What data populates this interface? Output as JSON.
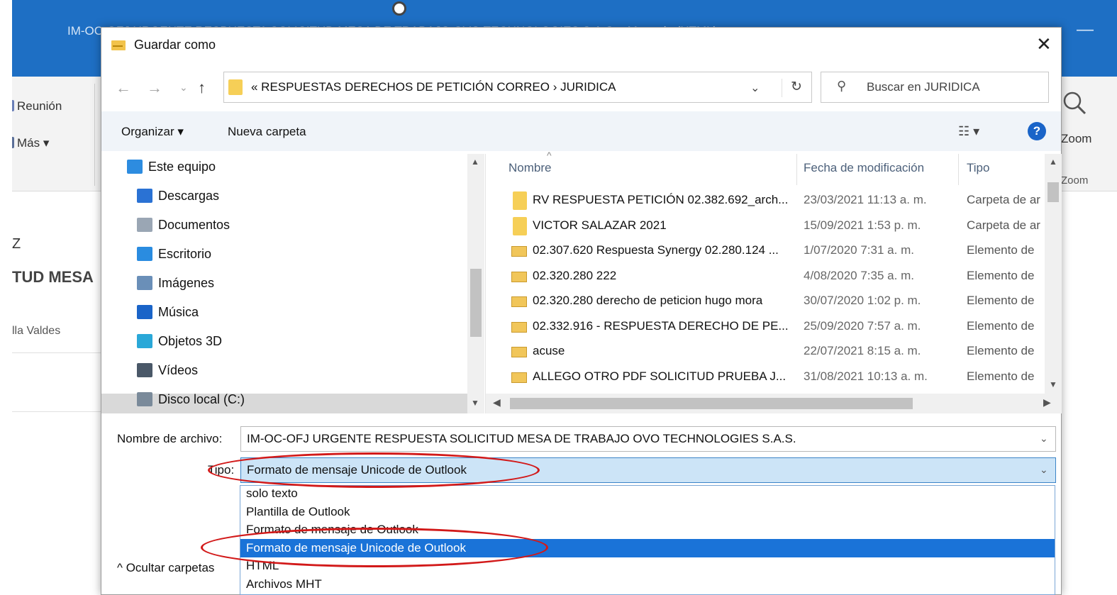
{
  "background": {
    "window_title": "IM-OC-OFJ URGENTE RESPUESTA SOLICITUD MESA DE TRABAJO OVO TECHNOLOGIES S.A.S. - Mensaje (HTML)",
    "minimize_glyph": "—",
    "ribbon": {
      "meeting_label": "Reunión",
      "more_label": "Más ▾",
      "zoom_label": "Zoom",
      "zoom_group_label": "Zoom"
    },
    "body": {
      "line1": "Z",
      "line2": "TUD MESA",
      "line3": "lla Valdes"
    }
  },
  "dialog": {
    "title": "Guardar como",
    "close_glyph": "✕",
    "address_path": "« RESPUESTAS DERECHOS DE PETICIÓN CORREO › JURIDICA",
    "search_placeholder": "Buscar en JURIDICA",
    "commands": {
      "organize": "Organizar ▾",
      "new_folder": "Nueva carpeta",
      "help": "?"
    },
    "tree": [
      {
        "label": "Este equipo",
        "icon": "computer-icon",
        "color": "#2d8ce0"
      },
      {
        "label": "Descargas",
        "icon": "download-icon",
        "color": "#2a72d4"
      },
      {
        "label": "Documentos",
        "icon": "documents-icon",
        "color": "#9aa6b4"
      },
      {
        "label": "Escritorio",
        "icon": "desktop-icon",
        "color": "#2a8ce0"
      },
      {
        "label": "Imágenes",
        "icon": "pictures-icon",
        "color": "#6a8fb8"
      },
      {
        "label": "Música",
        "icon": "music-icon",
        "color": "#1a64c8"
      },
      {
        "label": "Objetos 3D",
        "icon": "objects-3d-icon",
        "color": "#2aa8d8"
      },
      {
        "label": "Vídeos",
        "icon": "videos-icon",
        "color": "#4a5868"
      },
      {
        "label": "Disco local (C:)",
        "icon": "drive-icon",
        "color": "#7a8a9a"
      }
    ],
    "columns": {
      "name": "Nombre",
      "date": "Fecha de modificación",
      "type": "Tipo"
    },
    "files": [
      {
        "name": "RV RESPUESTA PETICIÓN 02.382.692_arch...",
        "date": "23/03/2021 11:13 a. m.",
        "type": "Carpeta de ar",
        "kind": "folder"
      },
      {
        "name": "VICTOR SALAZAR 2021",
        "date": "15/09/2021 1:53 p. m.",
        "type": "Carpeta de ar",
        "kind": "folder"
      },
      {
        "name": "02.307.620 Respuesta Synergy 02.280.124 ...",
        "date": "1/07/2020 7:31 a. m.",
        "type": "Elemento de",
        "kind": "mail"
      },
      {
        "name": "02.320.280   222",
        "date": "4/08/2020 7:35 a. m.",
        "type": "Elemento de",
        "kind": "mail"
      },
      {
        "name": "02.320.280 derecho de peticion hugo mora",
        "date": "30/07/2020 1:02 p. m.",
        "type": "Elemento de",
        "kind": "mail"
      },
      {
        "name": "02.332.916 - RESPUESTA DERECHO DE PE...",
        "date": "25/09/2020 7:57 a. m.",
        "type": "Elemento de",
        "kind": "mail"
      },
      {
        "name": "acuse",
        "date": "22/07/2021 8:15 a. m.",
        "type": "Elemento de",
        "kind": "mail"
      },
      {
        "name": "ALLEGO OTRO PDF SOLICITUD PRUEBA J...",
        "date": "31/08/2021 10:13 a. m.",
        "type": "Elemento de",
        "kind": "mail"
      }
    ],
    "filename_label": "Nombre de archivo:",
    "filename_value": "IM-OC-OFJ URGENTE RESPUESTA SOLICITUD MESA DE TRABAJO OVO TECHNOLOGIES S.A.S.",
    "type_label": "Tipo:",
    "type_value": "Formato de mensaje Unicode de Outlook",
    "type_options": [
      "solo texto",
      "Plantilla de Outlook",
      "Formato de mensaje de Outlook",
      "Formato de mensaje Unicode de Outlook",
      "HTML",
      "Archivos MHT"
    ],
    "type_selected_option": "Formato de mensaje Unicode de Outlook",
    "hide_folders_label": "Ocultar carpetas",
    "annotation_color": "#d21919"
  }
}
